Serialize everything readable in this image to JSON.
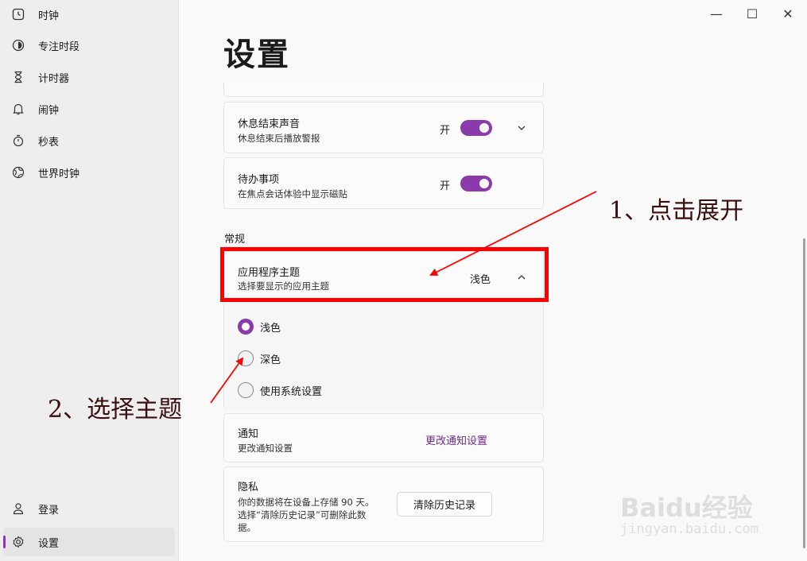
{
  "sidebar": {
    "items": [
      {
        "label": "时钟",
        "icon": "clock-icon"
      },
      {
        "label": "专注时段",
        "icon": "focus-icon"
      },
      {
        "label": "计时器",
        "icon": "hourglass-icon"
      },
      {
        "label": "闹钟",
        "icon": "bell-icon"
      },
      {
        "label": "秒表",
        "icon": "stopwatch-icon"
      },
      {
        "label": "世界时钟",
        "icon": "globe-icon"
      }
    ],
    "bottom_items": [
      {
        "label": "登录",
        "icon": "user-icon"
      },
      {
        "label": "设置",
        "icon": "gear-icon",
        "active": true
      }
    ]
  },
  "window_controls": {
    "minimize": "—",
    "maximize": "☐",
    "close": "✕"
  },
  "page": {
    "title": "设置"
  },
  "settings": {
    "break_sound": {
      "title": "休息结束声音",
      "desc": "休息结束后播放警报",
      "state": "开",
      "toggle_on": true
    },
    "todo": {
      "title": "待办事项",
      "desc": "在焦点会话体验中显示磁贴",
      "state": "开",
      "toggle_on": true
    },
    "section_general": "常规",
    "theme": {
      "title": "应用程序主题",
      "desc": "选择要显示的应用主题",
      "value": "浅色",
      "options": [
        {
          "label": "浅色",
          "selected": true
        },
        {
          "label": "深色",
          "selected": false
        },
        {
          "label": "使用系统设置",
          "selected": false
        }
      ]
    },
    "notifications": {
      "title": "通知",
      "desc": "更改通知设置",
      "link": "更改通知设置"
    },
    "privacy": {
      "title": "隐私",
      "desc_line1": "你的数据将在设备上存储 90 天。",
      "desc_line2": "选择“清除历史记录”可删除此数",
      "desc_line3": "据。",
      "button": "清除历史记录"
    }
  },
  "annotations": {
    "step1": "1、点击展开",
    "step2": "2、选择主题",
    "colors": {
      "annotation": "#ff0000",
      "accent": "#8a3aab"
    }
  },
  "watermark": {
    "main": "Baidu经验",
    "sub": "jingyan.baidu.com"
  }
}
